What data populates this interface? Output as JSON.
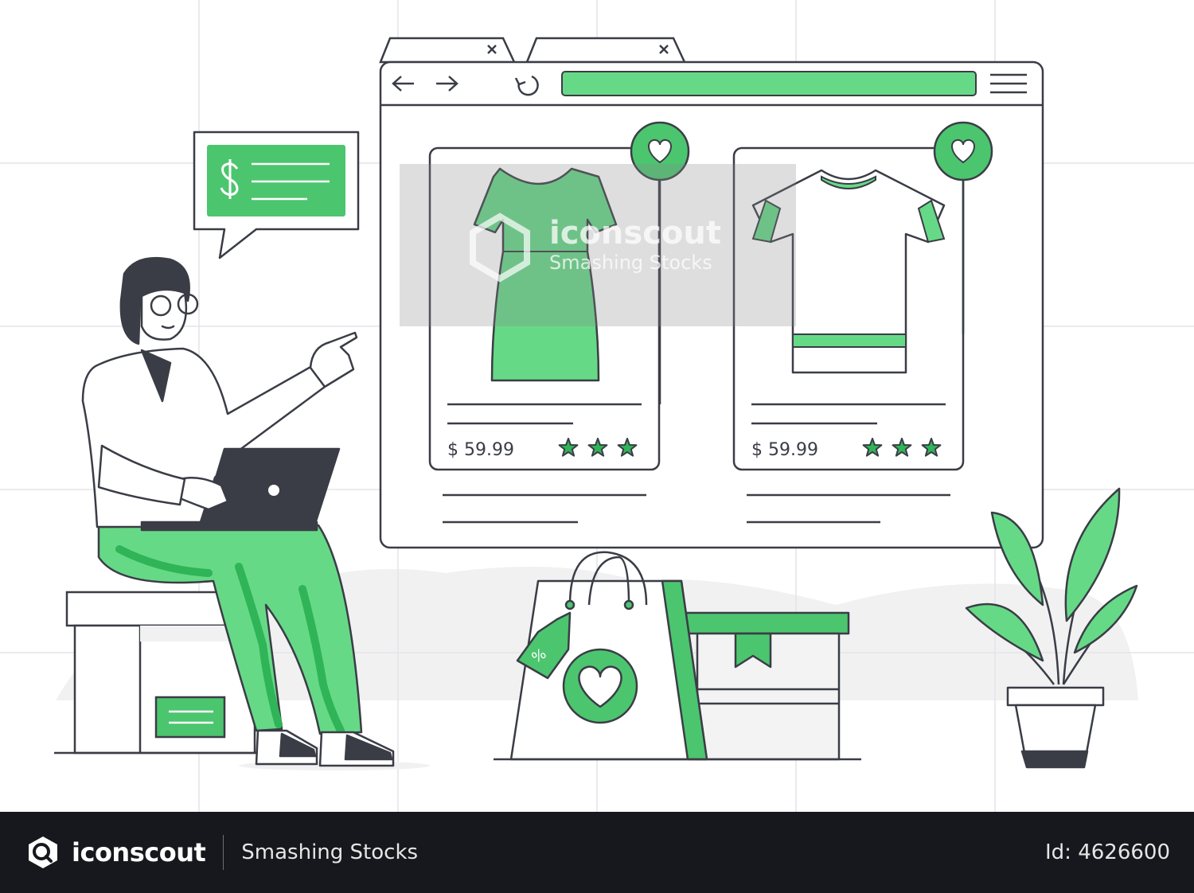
{
  "products": [
    {
      "price": "$ 59.99",
      "rating": 3,
      "rating_max": 3
    },
    {
      "price": "$ 59.99",
      "rating": 3,
      "rating_max": 3
    }
  ],
  "tag_label": "%",
  "watermark": {
    "brand": "iconscout",
    "tagline": "Smashing Stocks"
  },
  "footer": {
    "brand": "iconscout",
    "tagline": "Smashing Stocks",
    "asset_id": "Id: 4626600"
  },
  "colors": {
    "green": "#66d987",
    "green_dark": "#2fb457",
    "ink": "#3a3d46",
    "footer_bg": "#16181d"
  }
}
